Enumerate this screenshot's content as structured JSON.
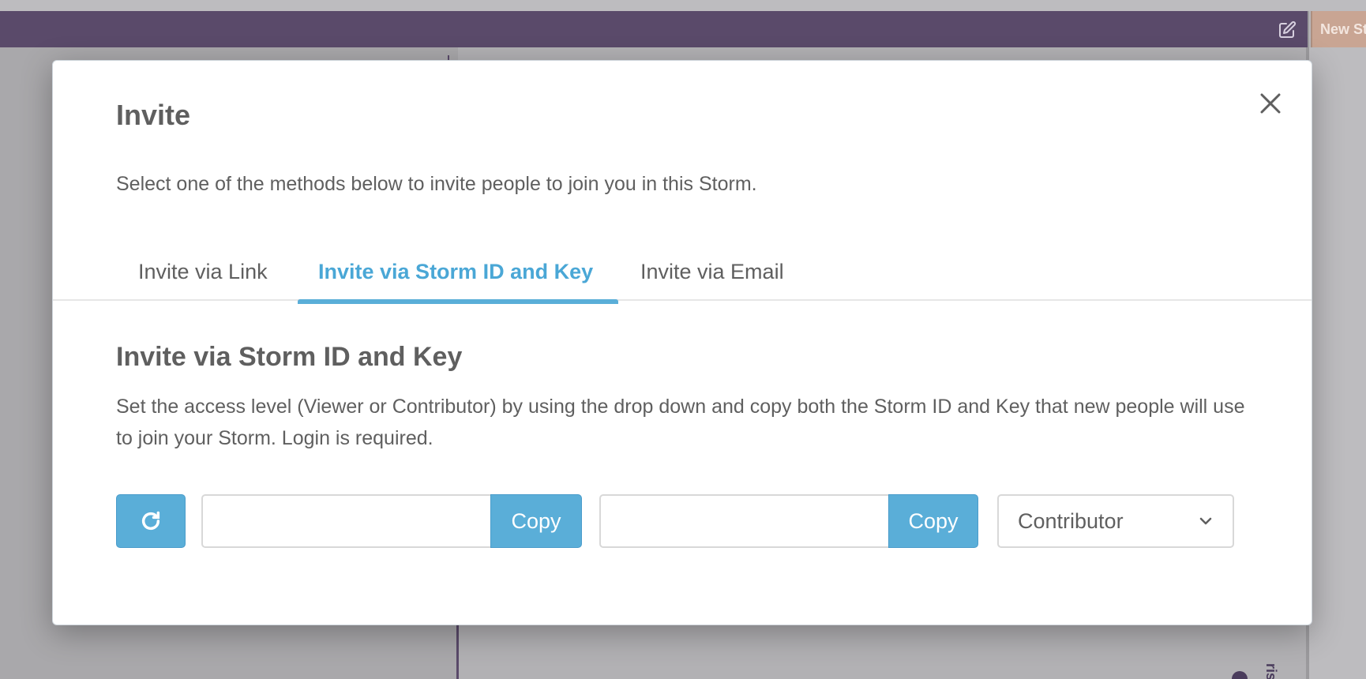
{
  "background": {
    "new_storm_label": "New Storm",
    "vertical_label": "ris"
  },
  "modal": {
    "title": "Invite",
    "subtitle": "Select one of the methods below to invite people to join you in this Storm.",
    "tabs": [
      {
        "label": "Invite via Link",
        "active": false
      },
      {
        "label": "Invite via Storm ID and Key",
        "active": true
      },
      {
        "label": "Invite via Email",
        "active": false
      }
    ],
    "section": {
      "title": "Invite via Storm ID and Key",
      "description": "Set the access level (Viewer or Contributor) by using the drop down and copy both the Storm ID and Key that new people will use to join your Storm. Login is required.",
      "storm_id": {
        "value": "",
        "copy_label": "Copy"
      },
      "storm_key": {
        "value": "",
        "copy_label": "Copy"
      },
      "access_level": {
        "selected": "Contributor"
      }
    }
  },
  "colors": {
    "accent": "#5aaed8",
    "header": "#5a4a6a",
    "text": "#5f5f5f"
  }
}
